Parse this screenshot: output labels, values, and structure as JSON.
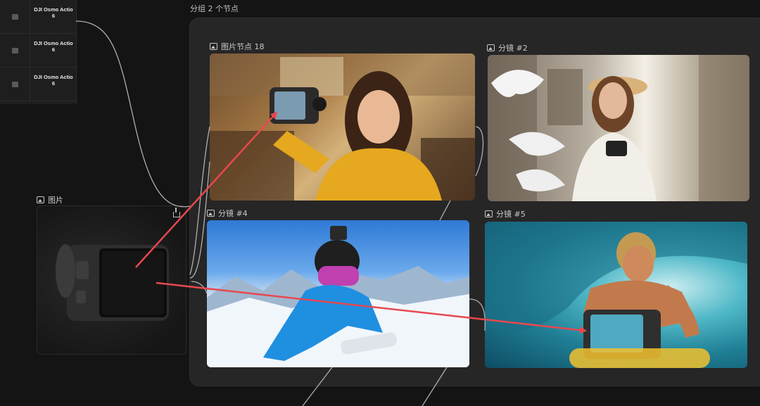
{
  "left_list": {
    "items": [
      {
        "label": "DJI Osmo Actio\n6"
      },
      {
        "label": "DJI Osmo Actio\n6"
      },
      {
        "label": "DJI Osmo Actio\n6"
      }
    ]
  },
  "group": {
    "title": "分组 2 个节点",
    "nodes": {
      "image_node": {
        "title": "图片节点 18"
      },
      "shot2": {
        "title": "分镜 #2"
      },
      "shot4": {
        "title": "分镜 #4"
      },
      "shot5": {
        "title": "分镜 #5"
      }
    }
  },
  "source_image": {
    "title": "图片"
  },
  "colors": {
    "background": "#141414",
    "group_bg": "#262626",
    "arrow": "#e8484e",
    "connector": "#c8c8c8"
  }
}
